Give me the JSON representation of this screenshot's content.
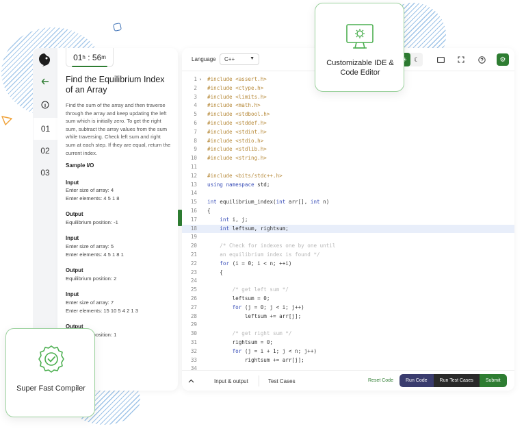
{
  "timer": {
    "hours": "01",
    "h_unit": "h",
    "sep": " : ",
    "minutes": "56",
    "m_unit": "m"
  },
  "sidebar": {
    "items": [
      {
        "label": "01"
      },
      {
        "label": "02"
      },
      {
        "label": "03"
      }
    ]
  },
  "problem": {
    "title": "Find the Equilibrium Index of an Array",
    "description": "Find the sum of the array and then traverse through the array and keep updating the left sum which is initially zero. To get the right sum, subtract the array values from the sum while traversing. Check left sum and right sum at each step. If they are equal, return the current index.",
    "sample_heading": "Sample I/O",
    "samples": [
      {
        "label": "Input",
        "lines": [
          "Enter size of array: 4",
          "Enter elements: 4 5 1 8"
        ]
      },
      {
        "label": "Output",
        "lines": [
          "Equilibrium position: -1"
        ]
      },
      {
        "label": "Input",
        "lines": [
          "Enter size of array: 5",
          "Enter elements: 4 5 1 8 1"
        ]
      },
      {
        "label": "Output",
        "lines": [
          "Equilibrium position: 2"
        ]
      },
      {
        "label": "Input",
        "lines": [
          "Enter size of array: 7",
          "Enter elements: 15 10 5 4 2 1 3"
        ]
      },
      {
        "label": "Output",
        "lines": [
          "Equilibrium position: 1"
        ]
      }
    ]
  },
  "editor": {
    "language_label": "Language",
    "language_value": "C++",
    "highlight_line": 18,
    "code": [
      "#include <assert.h>",
      "#include <ctype.h>",
      "#include <limits.h>",
      "#include <math.h>",
      "#include <stdbool.h>",
      "#include <stddef.h>",
      "#include <stdint.h>",
      "#include <stdio.h>",
      "#include <stdlib.h>",
      "#include <string.h>",
      "",
      "#include <bits/stdc++.h>",
      "using namespace std;",
      "",
      "int equilibrium_index(int arr[], int n)",
      "{",
      "    int i, j;",
      "    int leftsum, rightsum;",
      "",
      "    /* Check for indexes one by one until",
      "    an equilibrium index is found */",
      "    for (i = 0; i < n; ++i)",
      "    {",
      "",
      "        /* get left sum */",
      "        leftsum = 0;",
      "        for (j = 0; j < i; j++)",
      "            leftsum += arr[j];",
      "",
      "        /* get right sum */",
      "        rightsum = 0;",
      "        for (j = i + 1; j < n; j++)",
      "            rightsum += arr[j];",
      ""
    ],
    "tabs": {
      "io": "Input & output",
      "tests": "Test Cases"
    },
    "reset_label": "Reset Code",
    "run_label": "Run Code",
    "run_tests_label": "Run Test Cases",
    "submit_label": "Submit"
  },
  "callouts": {
    "ide": "Customizable IDE & Code Editor",
    "compiler": "Super Fast Compiler"
  }
}
